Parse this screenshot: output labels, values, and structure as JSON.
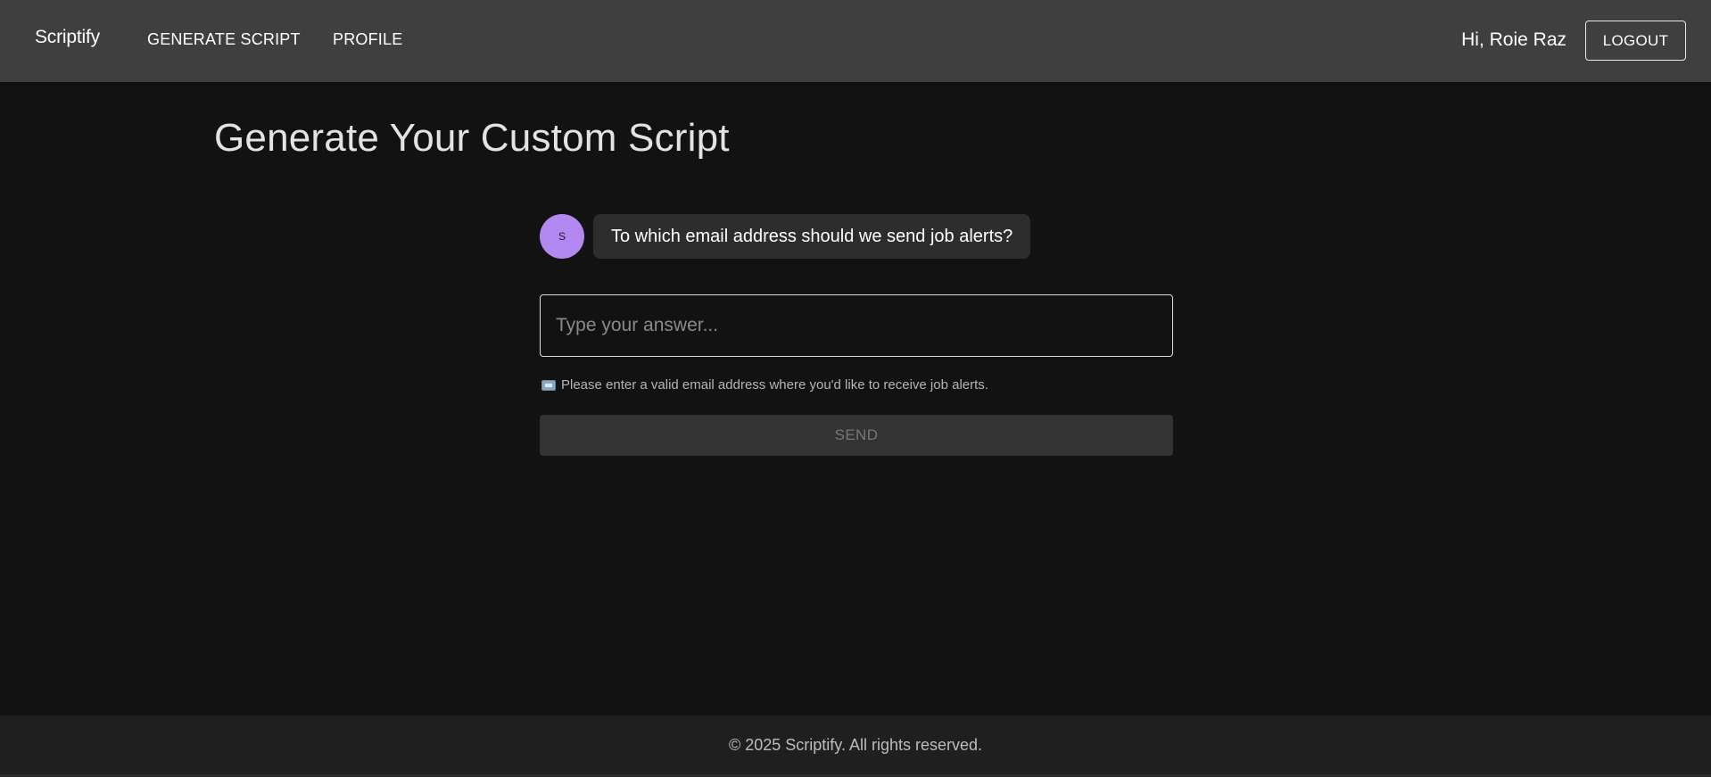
{
  "header": {
    "brand": "Scriptify",
    "nav": {
      "generate_script": "GENERATE SCRIPT",
      "profile": "PROFILE"
    },
    "greeting": "Hi, Roie Raz",
    "logout_label": "LOGOUT"
  },
  "main": {
    "title": "Generate Your Custom Script",
    "chat": {
      "avatar_letter": "S",
      "avatar_color": "#b388f0",
      "question": "To which email address should we send job alerts?"
    },
    "answer": {
      "value": "",
      "placeholder": "Type your answer..."
    },
    "helper": {
      "icon": "email-icon",
      "text": "Please enter a valid email address where you'd like to receive job alerts."
    },
    "send_label": "SEND"
  },
  "footer": {
    "text": "© 2025 Scriptify. All rights reserved."
  },
  "colors": {
    "background": "#121212",
    "header_background": "#3f3f3f",
    "footer_background": "#1f1f1f",
    "bubble_background": "#2d2d2d",
    "send_disabled": "#333333"
  }
}
